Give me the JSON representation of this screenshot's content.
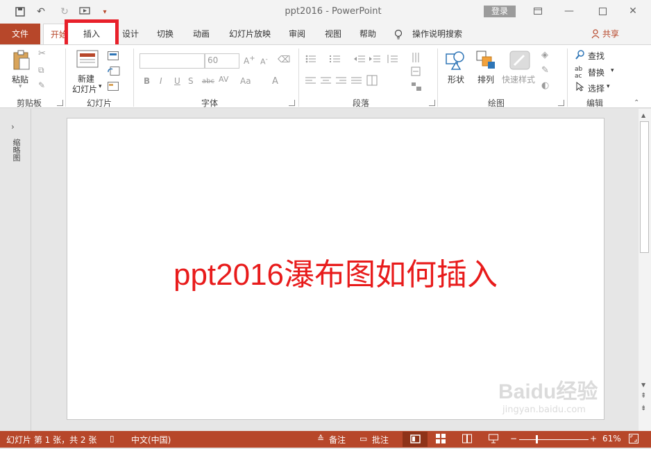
{
  "window": {
    "title": "ppt2016 - PowerPoint",
    "login": "登录"
  },
  "tabs": {
    "file": "文件",
    "home": "开始",
    "insert": "插入",
    "design": "设计",
    "transitions": "切换",
    "animations": "动画",
    "slideshow": "幻灯片放映",
    "review": "审阅",
    "view": "视图",
    "help": "帮助",
    "tellme": "操作说明搜索",
    "share": "共享"
  },
  "ribbon": {
    "clipboard": {
      "label": "剪贴板",
      "paste": "粘贴"
    },
    "slides": {
      "label": "幻灯片",
      "new_slide_line1": "新建",
      "new_slide_line2": "幻灯片"
    },
    "font": {
      "label": "字体",
      "size": "60"
    },
    "paragraph": {
      "label": "段落"
    },
    "drawing": {
      "label": "绘图",
      "shapes": "形状",
      "arrange": "排列",
      "quick_styles": "快速样式"
    },
    "editing": {
      "label": "编辑",
      "find": "查找",
      "replace": "替换",
      "select": "选择"
    }
  },
  "left_pane": {
    "label": "缩略图"
  },
  "slide": {
    "text": "ppt2016瀑布图如何插入"
  },
  "status": {
    "slide_info": "幻灯片 第 1 张，共 2 张",
    "language": "中文(中国)",
    "notes": "备注",
    "comments": "批注",
    "zoom": "61%"
  },
  "watermark": {
    "line1": "Baidu经验",
    "line2": "jingyan.baidu.com"
  },
  "colors": {
    "accent": "#b7472a",
    "highlight": "#e8202a",
    "slide_text": "#e81b1b"
  }
}
